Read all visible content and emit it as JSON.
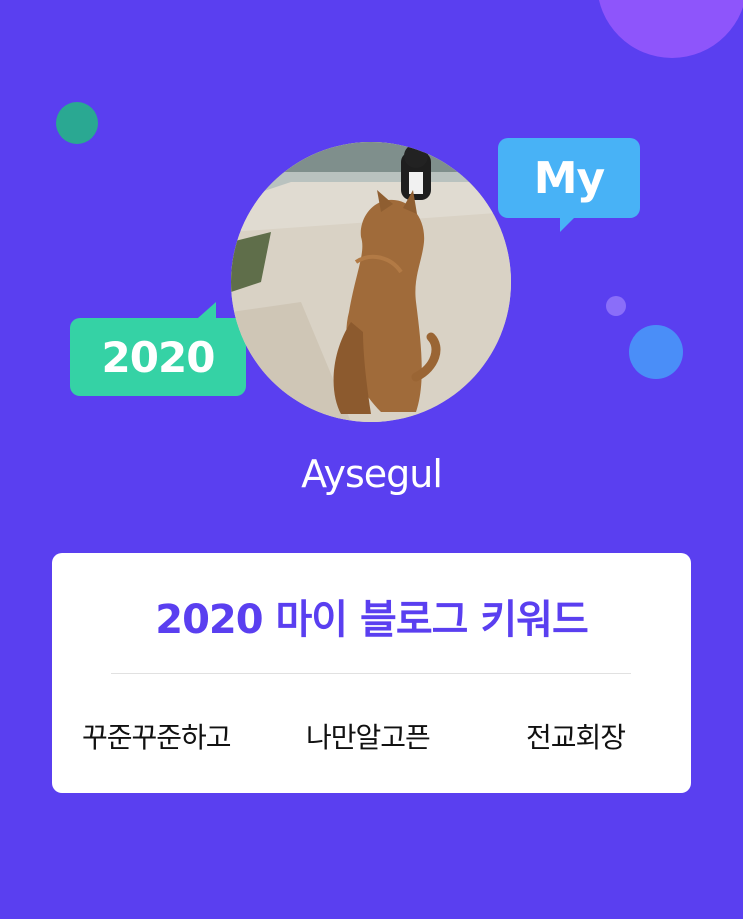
{
  "colors": {
    "background": "#5a3ff0",
    "accent": "#5a3ff0",
    "my_bubble": "#48b2f6",
    "year_bubble": "#35d2a5",
    "card": "#ffffff"
  },
  "badges": {
    "my": "My",
    "year": "2020"
  },
  "profile": {
    "avatar_icon": "cat-photo",
    "username": "Aysegul"
  },
  "card": {
    "title": "2020 마이 블로그 키워드",
    "keywords": [
      "꾸준꾸준하고",
      "나만알고픈",
      "전교회장"
    ]
  }
}
